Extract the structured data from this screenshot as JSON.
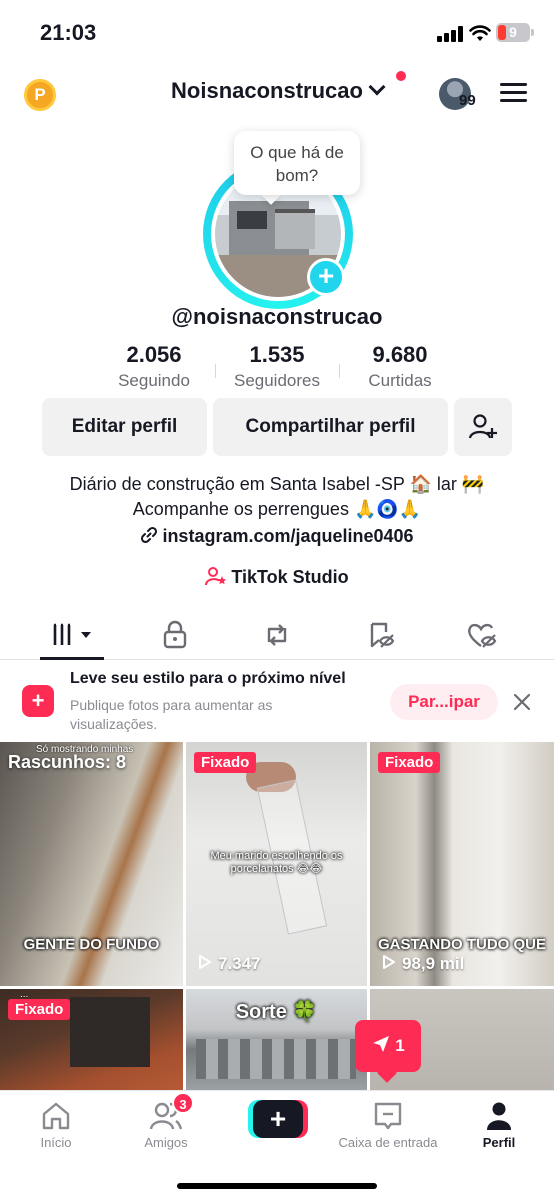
{
  "status": {
    "time": "21:03",
    "battery": "9"
  },
  "header": {
    "coin_label": "P",
    "username": "Noisnaconstrucao",
    "avatar_count": "99"
  },
  "profile": {
    "bubble": "O que há de bom?",
    "handle": "@noisnaconstrucao",
    "stats": [
      {
        "value": "2.056",
        "label": "Seguindo"
      },
      {
        "value": "1.535",
        "label": "Seguidores"
      },
      {
        "value": "9.680",
        "label": "Curtidas"
      }
    ],
    "buttons": {
      "edit": "Editar perfil",
      "share": "Compartilhar perfil"
    },
    "bio_line1": "Diário de construção em Santa Isabel -SP 🏠 lar 🚧",
    "bio_line2": "Acompanhe os perrengues 🙏🧿🙏",
    "link": "instagram.com/jaqueline0406",
    "studio": "TikTok Studio"
  },
  "promo": {
    "icon": "+",
    "title": "Leve seu estilo para o próximo nível",
    "subtitle": "Publique fotos para aumentar as visualizações.",
    "button": "Par...ipar"
  },
  "grid": {
    "drafts": "Rascunhos: 8",
    "tile1_top": "Só mostrando minhas",
    "tile1_caption": "GENTE DO FUNDO",
    "pinned": "Fixado",
    "tile2_caption": "Meu marido escolhendo os porcelanatos 😂😂",
    "tile2_views": "7.347",
    "tile3_caption": "GASTANDO TUDO QUE",
    "tile3_views": "98,9 mil",
    "tile4_top": "...",
    "tile5_caption": "Sorte 🍀"
  },
  "inbox_float": "1",
  "nav": {
    "items": [
      "Início",
      "Amigos",
      "Caixa de entrada",
      "Perfil"
    ],
    "friends_badge": "3",
    "create": "+"
  },
  "colors": {
    "accent": "#fe2c55",
    "cyan": "#25f4ee",
    "text": "#161823"
  }
}
